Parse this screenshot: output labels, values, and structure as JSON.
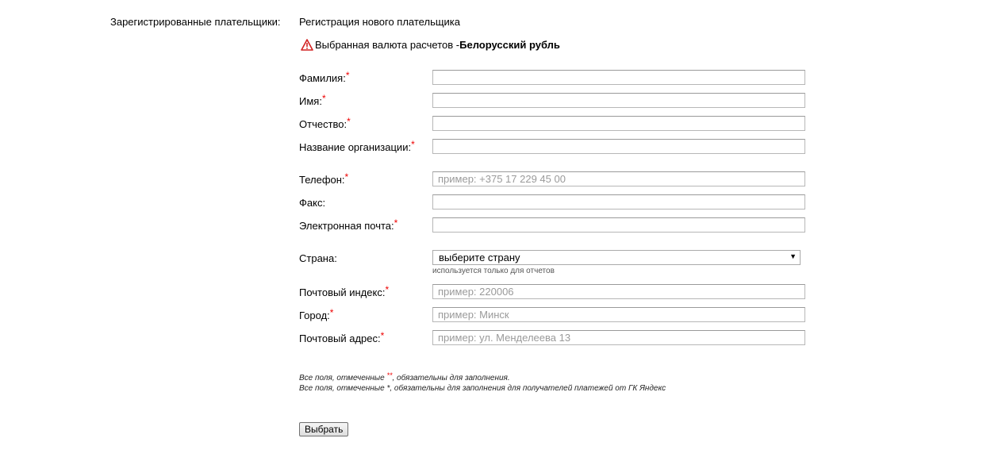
{
  "sidebar": {
    "title": "Зарегистрированные плательщики:"
  },
  "form": {
    "title": "Регистрация нового плательщика",
    "currency_notice": {
      "prefix": "Выбранная валюта расчетов - ",
      "currency": "Белорусский рубль"
    },
    "required_mark": "*",
    "fields": {
      "last_name": {
        "label": "Фамилия:",
        "value": "",
        "placeholder": ""
      },
      "first_name": {
        "label": "Имя:",
        "value": "",
        "placeholder": ""
      },
      "middle_name": {
        "label": "Отчество:",
        "value": "",
        "placeholder": ""
      },
      "organization": {
        "label": "Название организации:",
        "value": "",
        "placeholder": ""
      },
      "phone": {
        "label": "Телефон:",
        "value": "",
        "placeholder": "пример: +375 17 229 45 00"
      },
      "fax": {
        "label": "Факс:",
        "value": "",
        "placeholder": ""
      },
      "email": {
        "label": "Электронная почта:",
        "value": "",
        "placeholder": ""
      },
      "country": {
        "label": "Страна:",
        "selected": "выберите страну",
        "hint": "используется только для отчетов"
      },
      "postal_code": {
        "label": "Почтовый индекс:",
        "value": "",
        "placeholder": "пример: 220006"
      },
      "city": {
        "label": "Город:",
        "value": "",
        "placeholder": "пример: Минск"
      },
      "address": {
        "label": "Почтовый адрес:",
        "value": "",
        "placeholder": "пример: ул. Менделеева 13"
      }
    },
    "notes": {
      "line1_prefix": "Все поля, отмеченные ",
      "line1_mark": "**",
      "line1_suffix": ", обязательны для заполнения.",
      "line2": "Все поля, отмеченные *, обязательны для заполнения для получателей платежей от ГК Яндекс"
    },
    "submit_label": "Выбрать"
  },
  "colors": {
    "required": "#e00000",
    "warning_icon": "#d22222"
  },
  "icons": {
    "currency_notice": "warning-icon"
  }
}
